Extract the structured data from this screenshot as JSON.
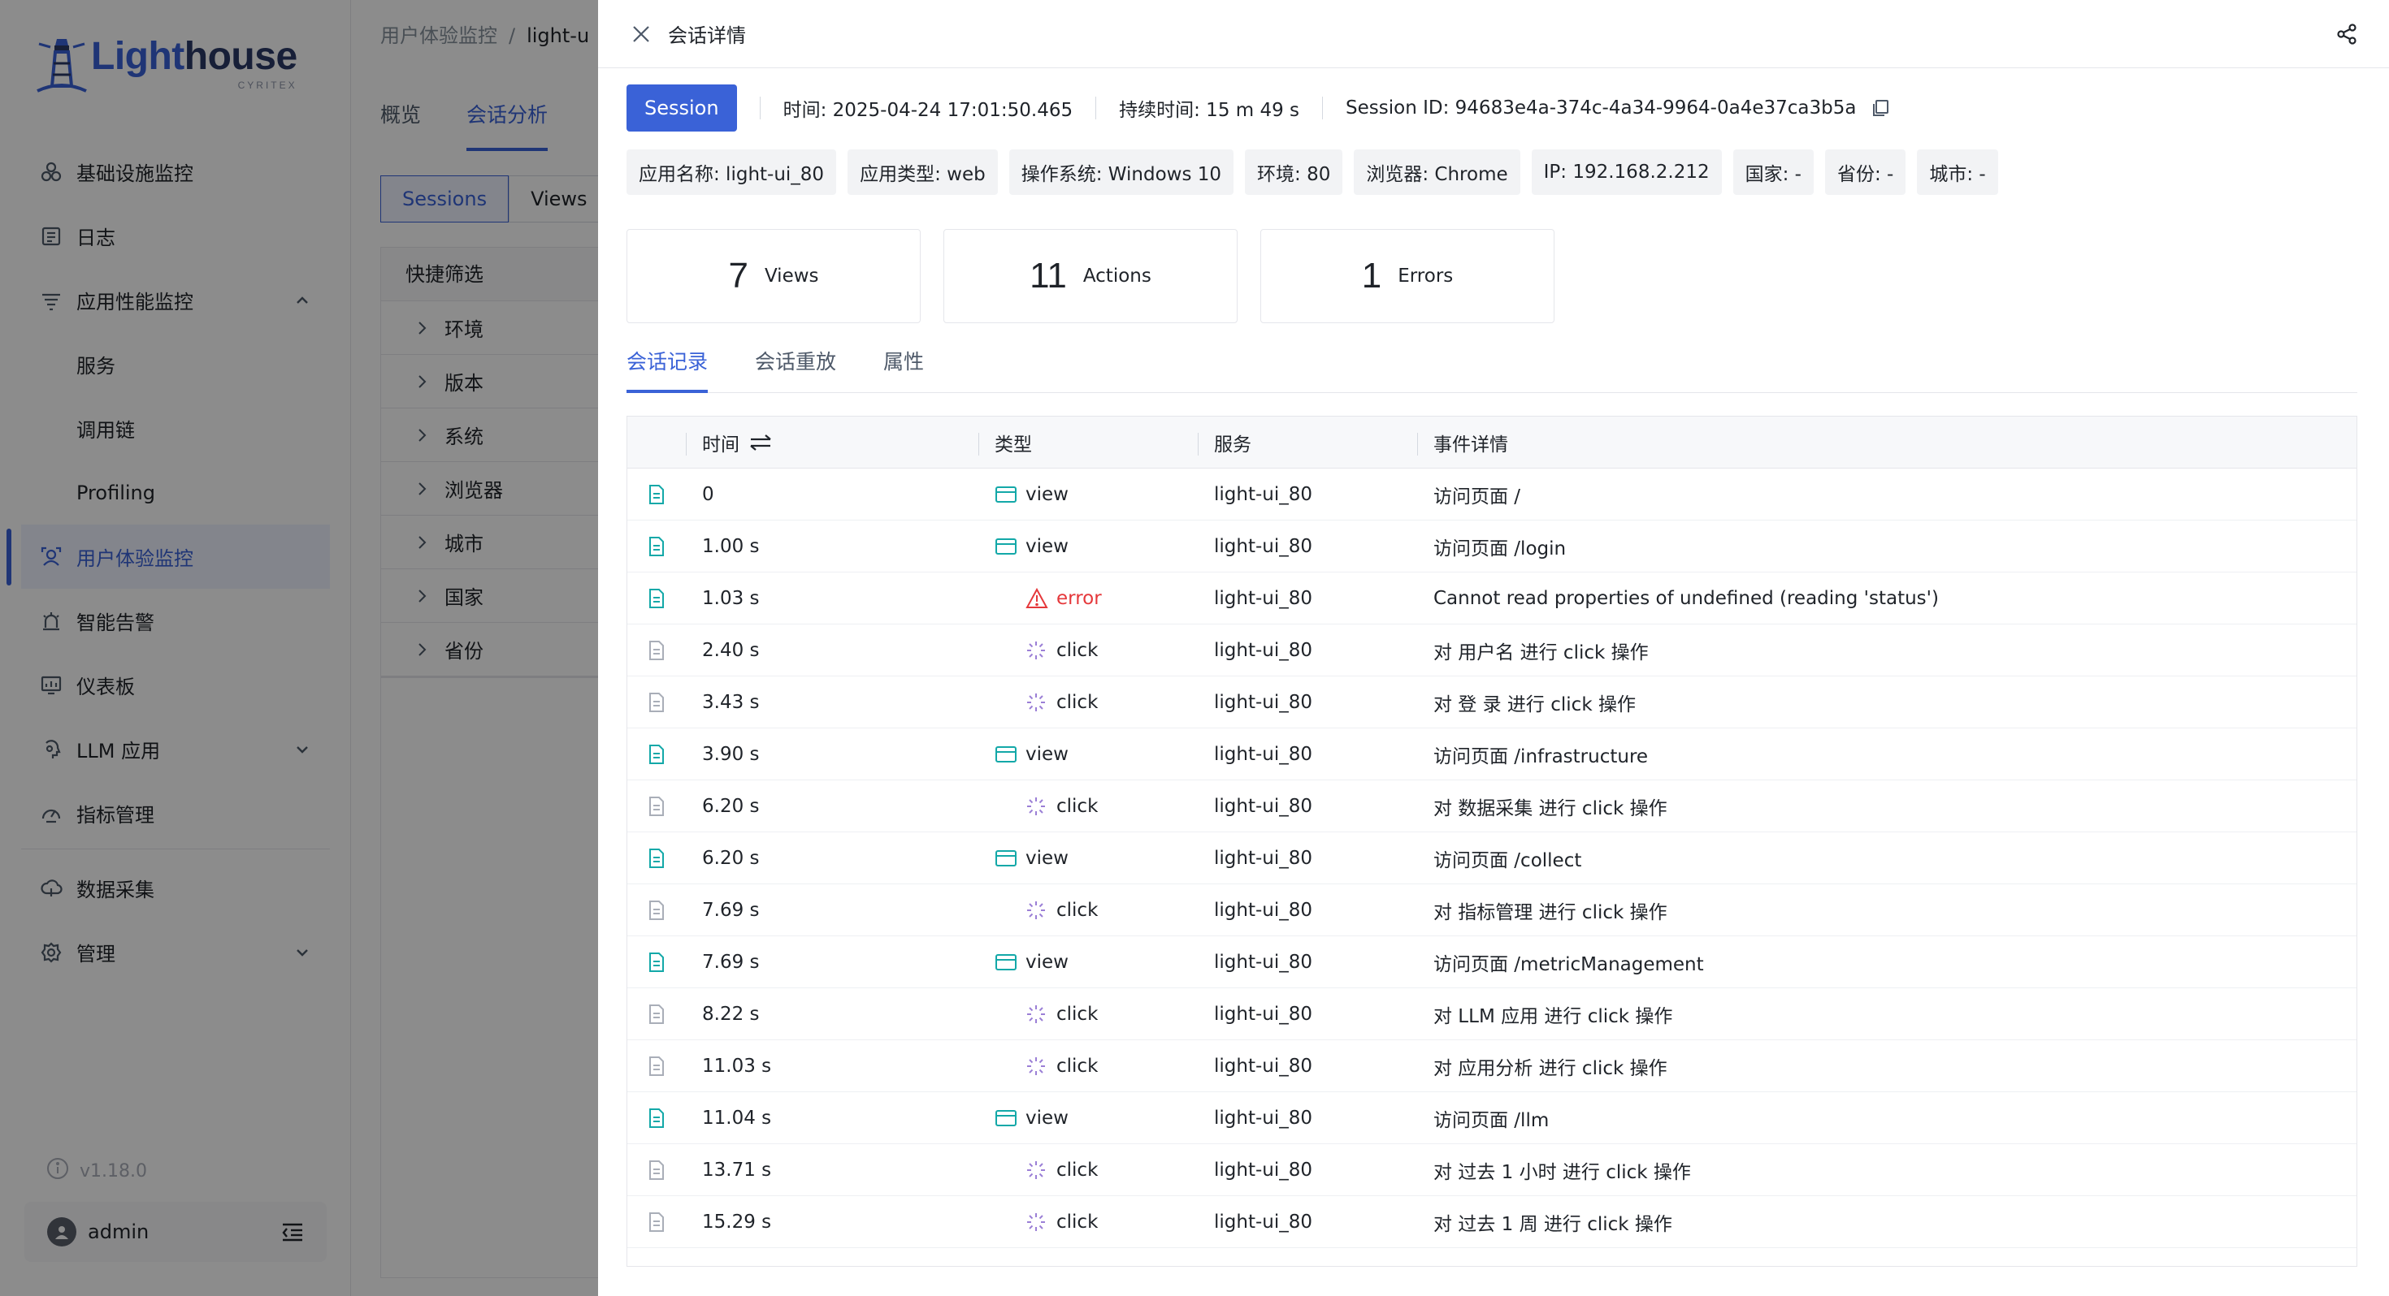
{
  "sidebar": {
    "logo": {
      "part1": "Light",
      "part2": "house",
      "sub": "CYRITEX"
    },
    "items": [
      {
        "label": "基础设施监控",
        "icon": "infrastructure-icon"
      },
      {
        "label": "日志",
        "icon": "log-icon"
      },
      {
        "label": "应用性能监控",
        "icon": "apm-icon",
        "expanded": true
      },
      {
        "label": "服务",
        "sub": true
      },
      {
        "label": "调用链",
        "sub": true
      },
      {
        "label": "Profiling",
        "sub": true
      },
      {
        "label": "用户体验监控",
        "icon": "user-experience-icon",
        "active": true
      },
      {
        "label": "智能告警",
        "icon": "alert-icon"
      },
      {
        "label": "仪表板",
        "icon": "dashboard-icon"
      },
      {
        "label": "LLM 应用",
        "icon": "llm-icon"
      },
      {
        "label": "指标管理",
        "icon": "metric-icon"
      },
      {
        "label": "数据采集",
        "icon": "data-collect-icon"
      },
      {
        "label": "管理",
        "icon": "admin-icon"
      }
    ],
    "version": "v1.18.0",
    "user": "admin"
  },
  "page": {
    "breadcrumb": [
      "用户体验监控",
      "light-u"
    ],
    "tabs": [
      "概览",
      "会话分析"
    ],
    "segments": [
      "Sessions",
      "Views"
    ],
    "filter_title": "快捷筛选",
    "filters": [
      "环境",
      "版本",
      "系统",
      "浏览器",
      "城市",
      "国家",
      "省份"
    ]
  },
  "drawer": {
    "title": "会话详情",
    "session_button": "Session",
    "time": "时间: 2025-04-24 17:01:50.465",
    "duration": "持续时间: 15 m 49 s",
    "session_id": "Session ID: 94683e4a-374c-4a34-9964-0a4e37ca3b5a",
    "tags": [
      "应用名称: light-ui_80",
      "应用类型: web",
      "操作系统: Windows 10",
      "环境: 80",
      "浏览器: Chrome",
      "IP: 192.168.2.212",
      "国家: -",
      "省份: -",
      "城市: -"
    ],
    "stats": [
      {
        "value": "7",
        "label": "Views"
      },
      {
        "value": "11",
        "label": "Actions"
      },
      {
        "value": "1",
        "label": "Errors"
      }
    ],
    "tabs": [
      "会话记录",
      "会话重放",
      "属性"
    ],
    "table": {
      "headers": [
        "时间",
        "类型",
        "服务",
        "事件详情"
      ],
      "rows": [
        {
          "time": "0",
          "type": "view",
          "service": "light-ui_80",
          "detail": "访问页面 /"
        },
        {
          "time": "1.00 s",
          "type": "view",
          "service": "light-ui_80",
          "detail": "访问页面 /login"
        },
        {
          "time": "1.03 s",
          "type": "error",
          "service": "light-ui_80",
          "detail": "Cannot read properties of undefined (reading 'status')"
        },
        {
          "time": "2.40 s",
          "type": "click",
          "service": "light-ui_80",
          "detail": "对 用户名 进行 click 操作"
        },
        {
          "time": "3.43 s",
          "type": "click",
          "service": "light-ui_80",
          "detail": "对 登 录 进行 click 操作"
        },
        {
          "time": "3.90 s",
          "type": "view",
          "service": "light-ui_80",
          "detail": "访问页面 /infrastructure"
        },
        {
          "time": "6.20 s",
          "type": "click",
          "service": "light-ui_80",
          "detail": "对 数据采集 进行 click 操作"
        },
        {
          "time": "6.20 s",
          "type": "view",
          "service": "light-ui_80",
          "detail": "访问页面 /collect"
        },
        {
          "time": "7.69 s",
          "type": "click",
          "service": "light-ui_80",
          "detail": "对 指标管理 进行 click 操作"
        },
        {
          "time": "7.69 s",
          "type": "view",
          "service": "light-ui_80",
          "detail": "访问页面 /metricManagement"
        },
        {
          "time": "8.22 s",
          "type": "click",
          "service": "light-ui_80",
          "detail": "对 LLM 应用 进行 click 操作"
        },
        {
          "time": "11.03 s",
          "type": "click",
          "service": "light-ui_80",
          "detail": "对 应用分析 进行 click 操作"
        },
        {
          "time": "11.04 s",
          "type": "view",
          "service": "light-ui_80",
          "detail": "访问页面 /llm"
        },
        {
          "time": "13.71 s",
          "type": "click",
          "service": "light-ui_80",
          "detail": "对 过去 1 小时 进行 click 操作"
        },
        {
          "time": "15.29 s",
          "type": "click",
          "service": "light-ui_80",
          "detail": "对 过去 1 周 进行 click 操作"
        }
      ]
    }
  },
  "colors": {
    "accent": "#3a62d7",
    "view": "#13a8a8",
    "error": "#e5383b",
    "click": "#9b7fd6",
    "doc_teal": "#13a8a8",
    "doc_gray": "#a9aeb8"
  }
}
